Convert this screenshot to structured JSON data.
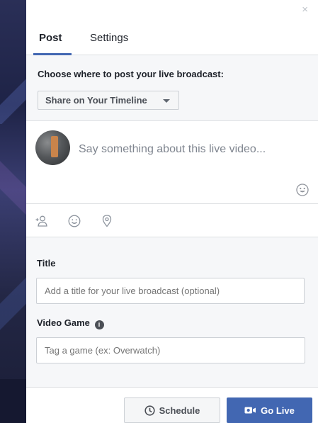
{
  "dialog": {
    "close_glyph": "×"
  },
  "tabs": {
    "post_label": "Post",
    "settings_label": "Settings",
    "active": "Post"
  },
  "destination": {
    "prompt": "Choose where to post your live broadcast:",
    "selected": "Share on Your Timeline"
  },
  "composer": {
    "placeholder": "Say something about this live video..."
  },
  "actions": {
    "icons": [
      "tag-people-icon",
      "feeling-icon",
      "location-icon"
    ]
  },
  "details": {
    "title_label": "Title",
    "title_placeholder": "Add a title for your live broadcast (optional)",
    "game_label": "Video Game",
    "game_info_glyph": "i",
    "game_placeholder": "Tag a game (ex: Overwatch)"
  },
  "footer": {
    "schedule_label": "Schedule",
    "go_live_label": "Go Live"
  },
  "colors": {
    "accent": "#4267b2",
    "background_gray": "#f6f7f9",
    "border": "#dddfe2"
  }
}
